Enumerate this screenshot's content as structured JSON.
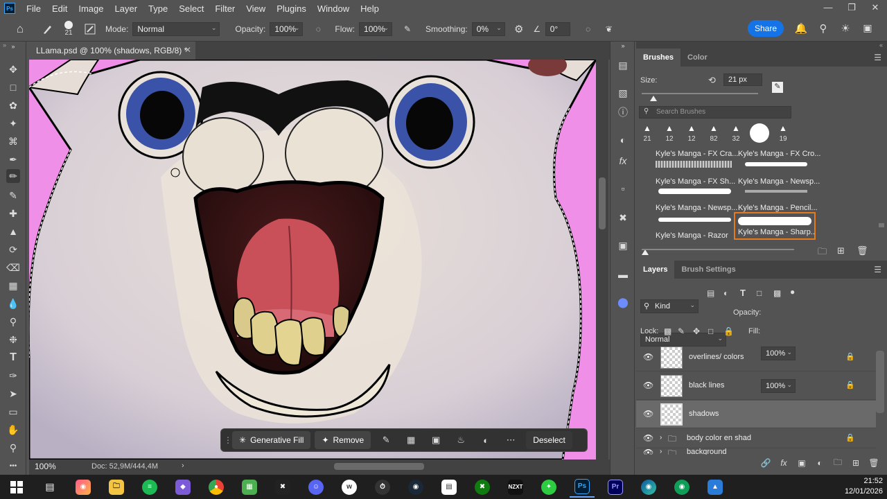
{
  "app": {
    "logo": "Ps",
    "menu": [
      "File",
      "Edit",
      "Image",
      "Layer",
      "Type",
      "Select",
      "Filter",
      "View",
      "Plugins",
      "Window",
      "Help"
    ]
  },
  "options": {
    "brush_size": "21",
    "mode_label": "Mode:",
    "mode_value": "Normal",
    "opacity_label": "Opacity:",
    "opacity_value": "100%",
    "flow_label": "Flow:",
    "flow_value": "100%",
    "smoothing_label": "Smoothing:",
    "smoothing_value": "0%",
    "angle_value": "0°",
    "share_label": "Share"
  },
  "document": {
    "tab_title": "LLama.psd @ 100% (shadows, RGB/8) *",
    "zoom": "100%",
    "doc_info": "Doc: 52,9M/444,4M"
  },
  "contextual_bar": {
    "generative_fill": "Generative Fill",
    "remove": "Remove",
    "deselect": "Deselect"
  },
  "brushes_panel": {
    "tabs": [
      "Brushes",
      "Color"
    ],
    "size_label": "Size:",
    "size_value": "21 px",
    "search_placeholder": "Search Brushes",
    "presets": [
      "21",
      "12",
      "12",
      "82",
      "32",
      "",
      "19"
    ],
    "brushes": [
      "Kyle's Manga - FX Cra...",
      "Kyle's Manga - FX Cro...",
      "Kyle's Manga - FX Sh...",
      "Kyle's Manga - Newsp...",
      "Kyle's Manga - Newsp...",
      "Kyle's Manga - Pencil...",
      "Kyle's Manga - Razor",
      "Kyle's Manga - Sharp..."
    ]
  },
  "layers_panel": {
    "tabs": [
      "Layers",
      "Brush Settings"
    ],
    "filter_kind": "Kind",
    "blend_mode": "Normal",
    "opacity_label": "Opacity:",
    "opacity_value": "100%",
    "lock_label": "Lock:",
    "fill_label": "Fill:",
    "fill_value": "100%",
    "layers": [
      {
        "name": "overlines/ colors"
      },
      {
        "name": "black lines"
      },
      {
        "name": "shadows"
      },
      {
        "name": "body color en shad"
      },
      {
        "name": "background"
      }
    ]
  },
  "taskbar": {
    "time": "21:52",
    "date": "12/01/2026",
    "apps": [
      "Ps",
      "Pr",
      "NZXT"
    ]
  },
  "colors": {
    "canvas_bg": "#f08fe8",
    "accent": "#1473e6",
    "selected_brush_border": "#e87a1e"
  }
}
